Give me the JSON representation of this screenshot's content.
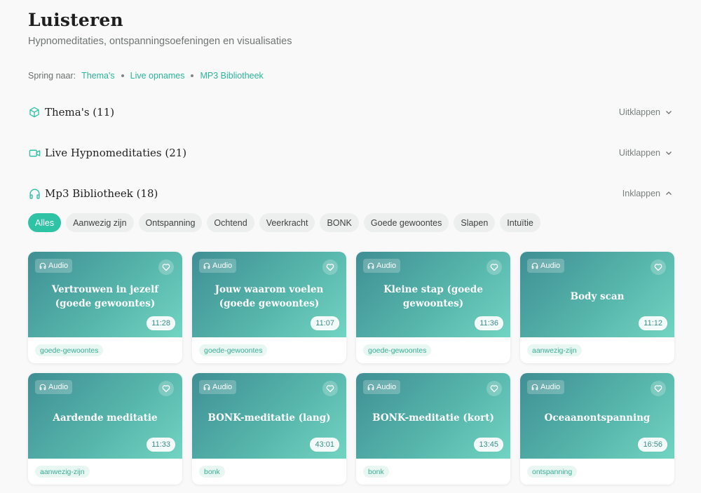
{
  "header": {
    "title": "Luisteren",
    "subtitle": "Hypnomeditaties, ontspanningsoefeningen en visualisaties"
  },
  "jump": {
    "label": "Spring naar:",
    "links": [
      "Thema's",
      "Live opnames",
      "MP3 Bibliotheek"
    ]
  },
  "sections": [
    {
      "title": "Thema's (11)",
      "toggle": "Uitklappen",
      "icon": "cube-icon"
    },
    {
      "title": "Live Hypnomeditaties (21)",
      "toggle": "Uitklappen",
      "icon": "video-icon"
    },
    {
      "title": "Mp3 Bibliotheek (18)",
      "toggle": "Inklappen",
      "icon": "headphones-icon"
    }
  ],
  "filters": {
    "active": "Alles",
    "items": [
      "Alles",
      "Aanwezig zijn",
      "Ontspanning",
      "Ochtend",
      "Veerkracht",
      "BONK",
      "Goede gewoontes",
      "Slapen",
      "Intuïtie"
    ]
  },
  "cards": [
    {
      "badge": "Audio",
      "title": "Vertrouwen in jezelf (goede gewoontes)",
      "duration": "11:28",
      "tag": "goede-gewoontes"
    },
    {
      "badge": "Audio",
      "title": "Jouw waarom voelen (goede gewoontes)",
      "duration": "11:07",
      "tag": "goede-gewoontes"
    },
    {
      "badge": "Audio",
      "title": "Kleine stap (goede gewoontes)",
      "duration": "11:36",
      "tag": "goede-gewoontes"
    },
    {
      "badge": "Audio",
      "title": "Body scan",
      "duration": "11:12",
      "tag": "aanwezig-zijn"
    },
    {
      "badge": "Audio",
      "title": "Aardende meditatie",
      "duration": "11:33",
      "tag": "aanwezig-zijn"
    },
    {
      "badge": "Audio",
      "title": "BONK-meditatie (lang)",
      "duration": "43:01",
      "tag": "bonk"
    },
    {
      "badge": "Audio",
      "title": "BONK-meditatie (kort)",
      "duration": "13:45",
      "tag": "bonk"
    },
    {
      "badge": "Audio",
      "title": "Oceaanontspanning",
      "duration": "16:56",
      "tag": "ontspanning"
    }
  ],
  "colors": {
    "accent": "#2fc3a6",
    "link": "#2bb59c",
    "card_gradient_start": "#3f8f94",
    "card_gradient_end": "#72d4c2"
  }
}
